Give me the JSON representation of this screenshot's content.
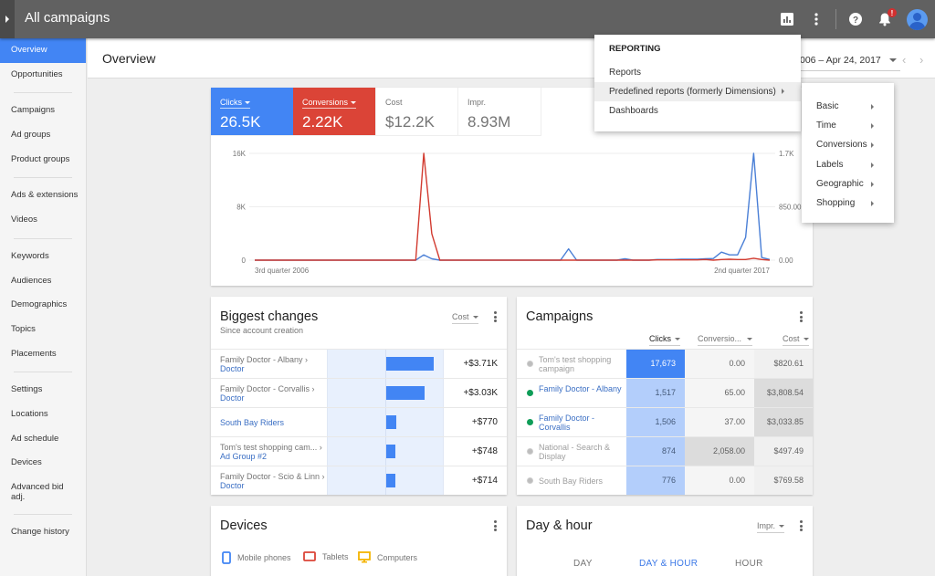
{
  "topbar": {
    "title": "All campaigns",
    "icons": [
      "reports-icon",
      "more-vert-icon",
      "help-icon",
      "notifications-icon",
      "account-avatar"
    ],
    "notification_badge": "!"
  },
  "sidebar": {
    "groups": [
      [
        {
          "label": "Overview",
          "active": true
        },
        {
          "label": "Opportunities"
        }
      ],
      [
        {
          "label": "Campaigns"
        },
        {
          "label": "Ad groups"
        },
        {
          "label": "Product groups"
        }
      ],
      [
        {
          "label": "Ads & extensions"
        },
        {
          "label": "Videos"
        }
      ],
      [
        {
          "label": "Keywords"
        },
        {
          "label": "Audiences"
        },
        {
          "label": "Demographics"
        },
        {
          "label": "Topics"
        },
        {
          "label": "Placements"
        }
      ],
      [
        {
          "label": "Settings"
        },
        {
          "label": "Locations"
        },
        {
          "label": "Ad schedule"
        },
        {
          "label": "Devices"
        },
        {
          "label": "Advanced bid adj."
        }
      ],
      [
        {
          "label": "Change history"
        }
      ]
    ]
  },
  "header": {
    "title": "Overview",
    "date_range": "006 – Apr 24, 2017"
  },
  "overview": {
    "metrics": [
      {
        "label": "Clicks",
        "value": "26.5K",
        "style": "blue",
        "dropdown": true
      },
      {
        "label": "Conversions",
        "value": "2.22K",
        "style": "red",
        "dropdown": true
      },
      {
        "label": "Cost",
        "value": "$12.2K",
        "style": "plain",
        "dropdown": false
      },
      {
        "label": "Impr.",
        "value": "8.93M",
        "style": "plain",
        "dropdown": false
      }
    ]
  },
  "chart_data": {
    "type": "line",
    "x_start_label": "3rd quarter 2006",
    "x_end_label": "2nd quarter 2017",
    "left_axis": {
      "label": "Clicks",
      "ticks": [
        "0",
        "8K",
        "16K"
      ],
      "range": [
        0,
        16000
      ]
    },
    "right_axis": {
      "label": "Conversions",
      "ticks": [
        "0.00",
        "850.00",
        "1.7K"
      ],
      "range": [
        0,
        1700
      ]
    },
    "grid": true,
    "series": [
      {
        "name": "Clicks",
        "color": "#4a7fd6",
        "axis": "left",
        "values": [
          0,
          0,
          0,
          0,
          0,
          0,
          0,
          0,
          0,
          0,
          0,
          0,
          0,
          0,
          0,
          0,
          0,
          0,
          0,
          0,
          0,
          800,
          200,
          0,
          0,
          0,
          0,
          0,
          0,
          0,
          0,
          0,
          0,
          0,
          0,
          0,
          0,
          0,
          0,
          1700,
          0,
          0,
          0,
          0,
          0,
          0,
          200,
          0,
          0,
          0,
          100,
          100,
          100,
          150,
          150,
          150,
          200,
          250,
          1200,
          800,
          800,
          3400,
          16000,
          400,
          100
        ]
      },
      {
        "name": "Conversions",
        "color": "#d23b30",
        "axis": "right",
        "values": [
          0,
          0,
          0,
          0,
          0,
          0,
          0,
          0,
          0,
          0,
          0,
          0,
          0,
          0,
          0,
          0,
          0,
          0,
          0,
          0,
          0,
          1700,
          420,
          0,
          0,
          0,
          0,
          0,
          0,
          0,
          0,
          0,
          0,
          0,
          0,
          0,
          0,
          0,
          0,
          0,
          0,
          0,
          0,
          0,
          0,
          0,
          0,
          0,
          0,
          0,
          5,
          5,
          5,
          5,
          5,
          5,
          10,
          0,
          10,
          15,
          10,
          10,
          30,
          10,
          0
        ]
      }
    ]
  },
  "biggest_changes": {
    "title": "Biggest changes",
    "subtitle": "Since account creation",
    "metric_dropdown": "Cost",
    "max_value": 3710,
    "rows": [
      {
        "parent": "Family Doctor - Albany ›",
        "child": "Doctor",
        "value": 3710,
        "value_label": "+$3.71K"
      },
      {
        "parent": "Family Doctor - Corvallis ›",
        "child": "Doctor",
        "value": 3030,
        "value_label": "+$3.03K"
      },
      {
        "parent": "",
        "child": "South Bay Riders",
        "value": 770,
        "value_label": "+$770"
      },
      {
        "parent": "Tom's test shopping cam... ›",
        "child": "Ad Group #2",
        "value": 748,
        "value_label": "+$748"
      },
      {
        "parent": "Family Doctor - Scio & Linn ›",
        "child": "Doctor",
        "value": 714,
        "value_label": "+$714"
      }
    ]
  },
  "campaigns": {
    "title": "Campaigns",
    "columns": [
      "Clicks",
      "Conversio...",
      "Cost"
    ],
    "rows": [
      {
        "name": "Tom's test shopping campaign",
        "status": "paused",
        "clicks": "17,673",
        "conversions": "0.00",
        "cost": "$820.61",
        "hot": [
          "clicks"
        ]
      },
      {
        "name": "Family Doctor - Albany",
        "status": "enabled",
        "clicks": "1,517",
        "conversions": "65.00",
        "cost": "$3,808.54",
        "hot": [
          "cost"
        ]
      },
      {
        "name": "Family Doctor - Corvallis",
        "status": "enabled",
        "clicks": "1,506",
        "conversions": "37.00",
        "cost": "$3,033.85",
        "hot": [
          "cost"
        ]
      },
      {
        "name": "National - Search & Display",
        "status": "paused",
        "clicks": "874",
        "conversions": "2,058.00",
        "cost": "$497.49",
        "hot": [
          "conversions"
        ]
      },
      {
        "name": "South Bay Riders",
        "status": "paused",
        "clicks": "776",
        "conversions": "0.00",
        "cost": "$769.58",
        "hot": []
      }
    ]
  },
  "devices": {
    "title": "Devices",
    "legend": [
      {
        "label": "Mobile phones",
        "icon": "mobile-phone-icon",
        "color": "#4285f4"
      },
      {
        "label": "Tablets",
        "icon": "tablet-icon",
        "color": "#db4437"
      },
      {
        "label": "Computers",
        "icon": "computer-icon",
        "color": "#f4b400"
      }
    ]
  },
  "day_hour": {
    "title": "Day & hour",
    "metric_dropdown": "Impr.",
    "tabs": [
      {
        "label": "DAY",
        "active": false
      },
      {
        "label": "DAY & HOUR",
        "active": true
      },
      {
        "label": "HOUR",
        "active": false
      }
    ]
  },
  "reporting_menu": {
    "heading": "REPORTING",
    "items": [
      {
        "label": "Reports",
        "submenu": false,
        "highlighted": false
      },
      {
        "label": "Predefined reports (formerly Dimensions)",
        "submenu": true,
        "highlighted": true
      },
      {
        "label": "Dashboards",
        "submenu": false,
        "highlighted": false
      }
    ]
  },
  "predefined_submenu": {
    "items": [
      "Basic",
      "Time",
      "Conversions",
      "Labels",
      "Geographic",
      "Shopping"
    ]
  },
  "colors": {
    "primary_blue": "#4285f4",
    "conversions_red": "#db4437",
    "enabled_green": "#0f9d58",
    "topbar": "#616161"
  }
}
